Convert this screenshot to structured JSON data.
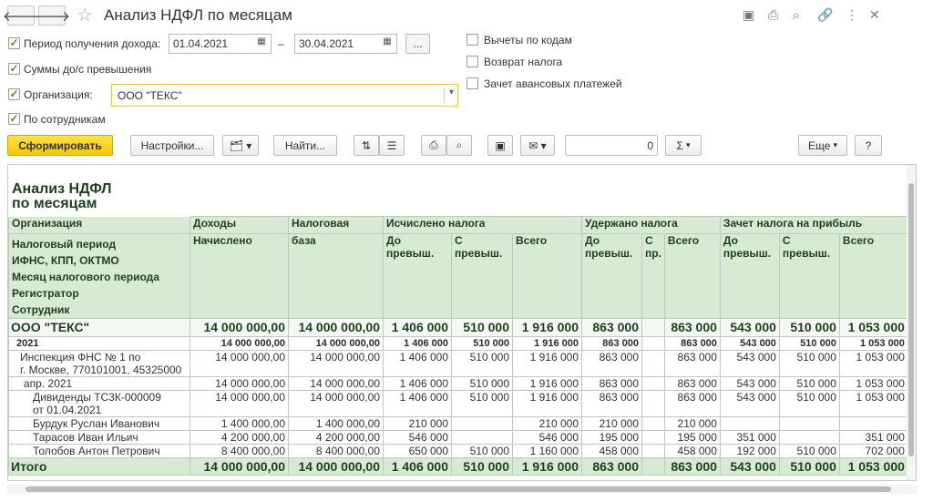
{
  "title": "Анализ НДФЛ по месяцам",
  "filters": {
    "period_label": "Период получения дохода:",
    "date_from": "01.04.2021",
    "dash": "–",
    "date_to": "30.04.2021",
    "ellipsis": "...",
    "amounts_label": "Суммы до/с превышения",
    "org_label": "Организация:",
    "org_value": "ООО \"ТЕКС\"",
    "by_employee_label": "По сотрудникам",
    "deductions_label": "Вычеты по кодам",
    "refund_label": "Возврат налога",
    "advance_label": "Зачет авансовых платежей"
  },
  "toolbar": {
    "generate": "Сформировать",
    "settings": "Настройки...",
    "find": "Найти...",
    "sum_value": "0",
    "sigma": "Σ",
    "more": "Еще",
    "help": "?"
  },
  "report": {
    "title": "Анализ НДФЛ\nпо месяцам",
    "row_headers": [
      "Организация",
      "Налоговый период",
      "ИФНС, КПП, ОКТМО",
      "Месяц налогового периода",
      "Регистратор",
      "Сотрудник"
    ],
    "groups": {
      "income": "Доходы",
      "base": "Налоговая",
      "calc": "Исчислено налога",
      "withheld": "Удержано налога",
      "offset": "Зачет налога на прибыль"
    },
    "sub": {
      "accrued": "Начислено",
      "base2": "база",
      "before": "До\nпревыш.",
      "after": "С\nпревыш.",
      "total": "Всего",
      "after_short": "С\nпр."
    },
    "rows": [
      {
        "cls": "org",
        "label": "ООО \"ТЕКС\"",
        "v": [
          "14 000 000,00",
          "14 000 000,00",
          "1 406 000",
          "510 000",
          "1 916 000",
          "863 000",
          "",
          "863 000",
          "543 000",
          "510 000",
          "1 053 000"
        ]
      },
      {
        "cls": "yr",
        "label": "2021",
        "v": [
          "14 000 000,00",
          "14 000 000,00",
          "1 406 000",
          "510 000",
          "1 916 000",
          "863 000",
          "",
          "863 000",
          "543 000",
          "510 000",
          "1 053 000"
        ]
      },
      {
        "cls": "",
        "label": "Инспекция ФНС № 1 по\nг. Москве, 770101001, 45325000",
        "v": [
          "14 000 000,00",
          "14 000 000,00",
          "1 406 000",
          "510 000",
          "1 916 000",
          "863 000",
          "",
          "863 000",
          "543 000",
          "510 000",
          "1 053 000"
        ]
      },
      {
        "cls": "",
        "label": "апр. 2021",
        "v": [
          "14 000 000,00",
          "14 000 000,00",
          "1 406 000",
          "510 000",
          "1 916 000",
          "863 000",
          "",
          "863 000",
          "543 000",
          "510 000",
          "1 053 000"
        ]
      },
      {
        "cls": "",
        "label": "Дивиденды ТС3К-000009\nот 01.04.2021",
        "v": [
          "14 000 000,00",
          "14 000 000,00",
          "1 406 000",
          "510 000",
          "1 916 000",
          "863 000",
          "",
          "863 000",
          "543 000",
          "510 000",
          "1 053 000"
        ]
      },
      {
        "cls": "",
        "label": "Бурдук Руслан Иванович",
        "v": [
          "1 400 000,00",
          "1 400 000,00",
          "210 000",
          "",
          "210 000",
          "210 000",
          "",
          "210 000",
          "",
          "",
          ""
        ]
      },
      {
        "cls": "",
        "label": "Тарасов Иван Ильич",
        "v": [
          "4 200 000,00",
          "4 200 000,00",
          "546 000",
          "",
          "546 000",
          "195 000",
          "",
          "195 000",
          "351 000",
          "",
          "351 000"
        ]
      },
      {
        "cls": "",
        "label": "Толобов Антон Петрович",
        "v": [
          "8 400 000,00",
          "8 400 000,00",
          "650 000",
          "510 000",
          "1 160 000",
          "458 000",
          "",
          "458 000",
          "192 000",
          "510 000",
          "702 000"
        ]
      },
      {
        "cls": "tot",
        "label": "Итого",
        "v": [
          "14 000 000,00",
          "14 000 000,00",
          "1 406 000",
          "510 000",
          "1 916 000",
          "863 000",
          "",
          "863 000",
          "543 000",
          "510 000",
          "1 053 000"
        ]
      }
    ]
  }
}
